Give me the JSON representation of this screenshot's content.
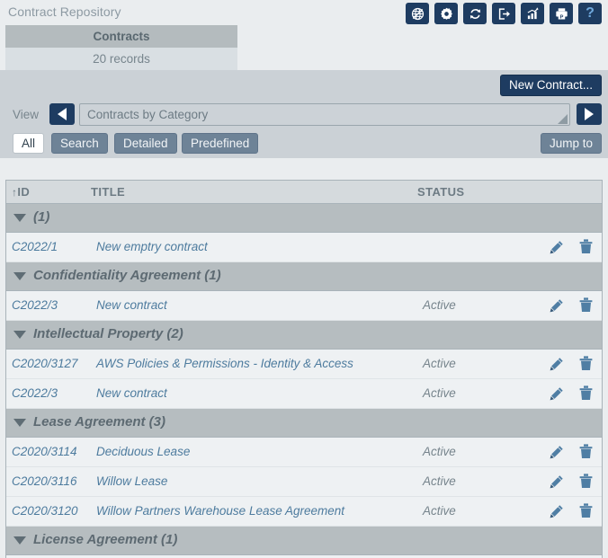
{
  "window": {
    "title": "Contract Repository"
  },
  "toolbar": {
    "icons": [
      {
        "name": "globe-network-icon",
        "title": "Network"
      },
      {
        "name": "gear-settings-icon",
        "title": "Settings"
      },
      {
        "name": "refresh-icon",
        "title": "Refresh"
      },
      {
        "name": "export-icon",
        "title": "Export"
      },
      {
        "name": "chart-icon",
        "title": "Chart"
      },
      {
        "name": "print-icon",
        "title": "Print"
      },
      {
        "name": "help-icon",
        "title": "Help",
        "glyph": "?"
      }
    ]
  },
  "tabs": {
    "active_label": "Contracts",
    "records_label": "20 records"
  },
  "actions": {
    "new_contract_label": "New Contract..."
  },
  "view": {
    "label": "View",
    "selected": "Contracts by Category",
    "prev_icon": "chevron-left-icon",
    "next_icon": "chevron-right-icon"
  },
  "filters": {
    "buttons": [
      {
        "label": "All",
        "selected": true
      },
      {
        "label": "Search",
        "selected": false
      },
      {
        "label": "Detailed",
        "selected": false
      },
      {
        "label": "Predefined",
        "selected": false
      }
    ],
    "jump_to_label": "Jump to"
  },
  "table": {
    "columns": {
      "id": "ID",
      "title": "TITLE",
      "status": "STATUS"
    },
    "sort_indicator": "↑",
    "groups": [
      {
        "label": "(1)",
        "rows": [
          {
            "id": "C2022/1",
            "title": "New emptry contract",
            "status": ""
          }
        ]
      },
      {
        "label": "Confidentiality Agreement (1)",
        "rows": [
          {
            "id": "C2022/3",
            "title": "New contract",
            "status": "Active"
          }
        ]
      },
      {
        "label": "Intellectual Property (2)",
        "rows": [
          {
            "id": "C2020/3127",
            "title": "AWS Policies & Permissions - Identity & Access",
            "status": "Active"
          },
          {
            "id": "C2022/3",
            "title": "New contract",
            "status": "Active"
          }
        ]
      },
      {
        "label": "Lease Agreement (3)",
        "rows": [
          {
            "id": "C2020/3114",
            "title": "Deciduous Lease",
            "status": "Active"
          },
          {
            "id": "C2020/3116",
            "title": "Willow Lease",
            "status": "Active"
          },
          {
            "id": "C2020/3120",
            "title": "Willow Partners Warehouse Lease Agreement",
            "status": "Active"
          }
        ]
      },
      {
        "label": "License Agreement (1)",
        "rows": []
      }
    ],
    "row_actions": [
      {
        "name": "edit-icon",
        "title": "Edit"
      },
      {
        "name": "delete-icon",
        "title": "Delete"
      }
    ]
  },
  "colors": {
    "page_bg": "#eaedef",
    "band": "#cbd1d6",
    "navy": "#1e3c61",
    "slate_button": "#6e8397",
    "group_header": "#b6bdc0",
    "row_bg": "#eef1f3",
    "link_text": "#4d7b9e"
  }
}
